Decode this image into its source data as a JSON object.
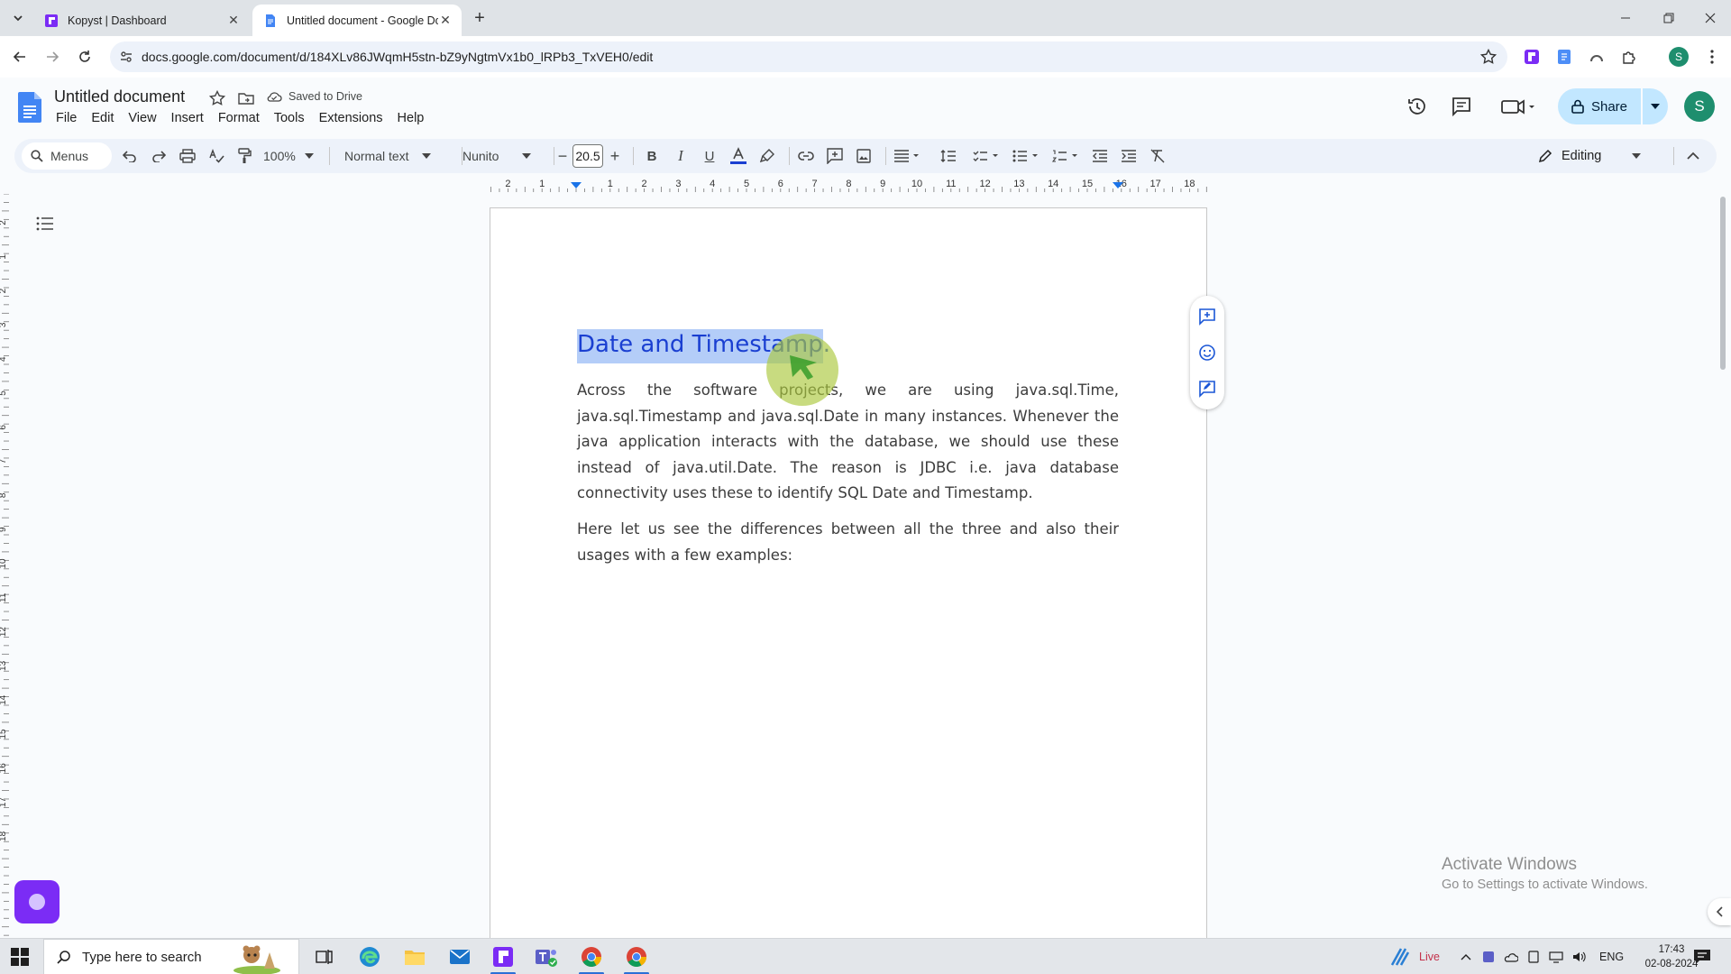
{
  "browser": {
    "tabs": [
      {
        "title": "Kopyst | Dashboard",
        "active": false
      },
      {
        "title": "Untitled document - Google Docs",
        "active": true
      }
    ],
    "url": "docs.google.com/document/d/184XLv86JWqmH5stn-bZ9yNgtmVx1b0_lRPb3_TxVEH0/edit",
    "profile_initial": "S"
  },
  "docs": {
    "title": "Untitled document",
    "saved_status": "Saved to Drive",
    "menu": [
      "File",
      "Edit",
      "View",
      "Insert",
      "Format",
      "Tools",
      "Extensions",
      "Help"
    ],
    "share_label": "Share",
    "account_initial": "S",
    "toolbar": {
      "menus_label": "Menus",
      "zoom": "100%",
      "style": "Normal text",
      "font": "Nunito",
      "font_size": "20.5",
      "mode": "Editing"
    },
    "ruler_numbers": [
      "2",
      "1",
      "1",
      "2",
      "3",
      "4",
      "5",
      "6",
      "7",
      "8",
      "9",
      "10",
      "11",
      "12",
      "13",
      "14",
      "15",
      "16",
      "17",
      "18"
    ],
    "content": {
      "heading_selected": "Date and Timestamp",
      "heading_rest": ".",
      "paragraph1": "Across the software projects, we are using java.sql.Time, java.sql.Timestamp and java.sql.Date in many instances. Whenever the java application interacts with the database, we should use these instead of java.util.Date. The reason is JDBC i.e. java database connectivity uses these to identify SQL Date and Timestamp.",
      "paragraph2": "Here let us see the differences between all the three and also their usages with a few examples:"
    }
  },
  "watermark": {
    "line1": "Activate Windows",
    "line2": "Go to Settings to activate Windows."
  },
  "taskbar": {
    "search_placeholder": "Type here to search",
    "weather": "Live",
    "language": "ENG",
    "time": "17:43",
    "date": "02-08-2024"
  },
  "colors": {
    "accent_blue": "#1a73e8",
    "share_bg": "#c2e7ff",
    "selection": "#b4cdf8",
    "heading": "#1a3fd1"
  }
}
